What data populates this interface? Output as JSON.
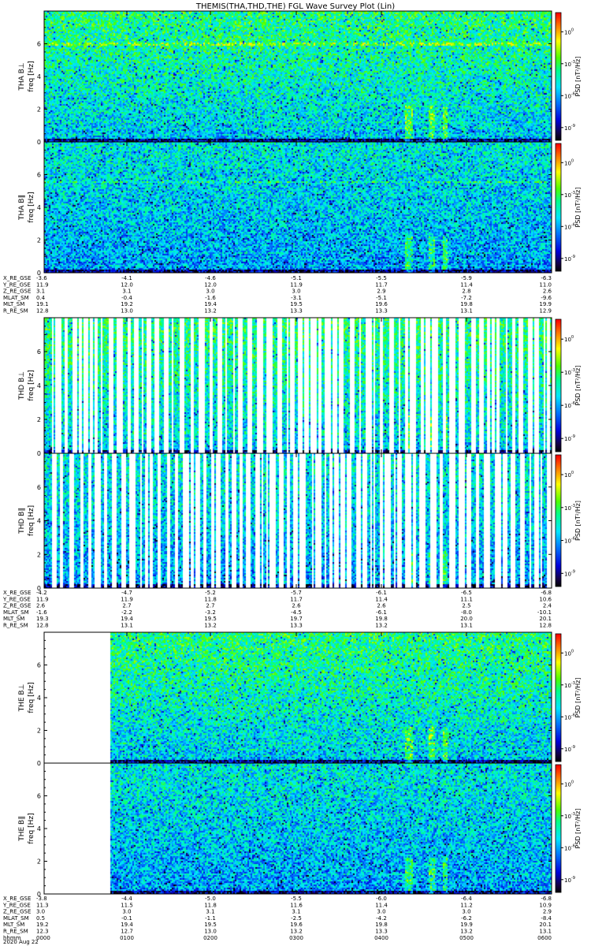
{
  "title": "THEMIS(THA,THD,THE) FGL Wave Survey Plot (Lin)",
  "colorbar_label": "PSD [nT²/Hz]",
  "colorbar_ticks": [
    {
      "exp": 0
    },
    {
      "exp": -3
    },
    {
      "exp": -6
    },
    {
      "exp": -9
    }
  ],
  "chart_data": {
    "type": "heatmap",
    "x_unit": "hhmm",
    "date": "2020 Aug 22",
    "x_ticks": [
      "0000",
      "0100",
      "0200",
      "0300",
      "0400",
      "0500",
      "0600"
    ],
    "x_range": [
      "0000",
      "0600"
    ],
    "ylim": [
      0,
      8
    ],
    "y_ticks": [
      0,
      2,
      4,
      6
    ],
    "color_scale": "log",
    "colormap": "rainbow",
    "panels": [
      {
        "probe": "THA",
        "component": "B⊥",
        "ylabel_probe": "THA B⊥",
        "ylabel_unit": "freq [Hz]",
        "coverage_start_fraction": 0.0,
        "gaps": false
      },
      {
        "probe": "THA",
        "component": "B∥",
        "ylabel_probe": "THA B∥",
        "ylabel_unit": "freq [Hz]",
        "coverage_start_fraction": 0.0,
        "gaps": false
      },
      {
        "probe": "THD",
        "component": "B⊥",
        "ylabel_probe": "THD B⊥",
        "ylabel_unit": "freq [Hz]",
        "coverage_start_fraction": 0.0,
        "gaps": true
      },
      {
        "probe": "THD",
        "component": "B∥",
        "ylabel_probe": "THD B∥",
        "ylabel_unit": "freq [Hz]",
        "coverage_start_fraction": 0.0,
        "gaps": true
      },
      {
        "probe": "THE",
        "component": "B⊥",
        "ylabel_probe": "THE B⊥",
        "ylabel_unit": "freq [Hz]",
        "coverage_start_fraction": 0.13,
        "gaps": false
      },
      {
        "probe": "THE",
        "component": "B∥",
        "ylabel_probe": "THE B∥",
        "ylabel_unit": "freq [Hz]",
        "coverage_start_fraction": 0.13,
        "gaps": false
      }
    ],
    "ephemeris_blocks": [
      {
        "probe": "THA",
        "rows": [
          {
            "label": "X_RE_GSE",
            "values": [
              "-3.6",
              "-4.1",
              "-4.6",
              "-5.1",
              "-5.5",
              "-5.9",
              "-6.3"
            ]
          },
          {
            "label": "Y_RE_GSE",
            "values": [
              "11.9",
              "12.0",
              "12.0",
              "11.9",
              "11.7",
              "11.4",
              "11.0"
            ]
          },
          {
            "label": "Z_RE_GSE",
            "values": [
              "3.1",
              "3.1",
              "3.0",
              "3.0",
              "2.9",
              "2.8",
              "2.6"
            ]
          },
          {
            "label": "MLAT_SM",
            "values": [
              "0.4",
              "-0.4",
              "-1.6",
              "-3.1",
              "-5.1",
              "-7.2",
              "-9.6"
            ]
          },
          {
            "label": "MLT_SM",
            "values": [
              "19.1",
              "19.2",
              "19.4",
              "19.5",
              "19.6",
              "19.8",
              "19.9"
            ]
          },
          {
            "label": "R_RE_SM",
            "values": [
              "12.8",
              "13.0",
              "13.2",
              "13.3",
              "13.3",
              "13.1",
              "12.9"
            ]
          }
        ]
      },
      {
        "probe": "THD",
        "rows": [
          {
            "label": "X_RE_GSE",
            "values": [
              "-4.2",
              "-4.7",
              "-5.2",
              "-5.7",
              "-6.1",
              "-6.5",
              "-6.8"
            ]
          },
          {
            "label": "Y_RE_GSE",
            "values": [
              "11.9",
              "11.9",
              "11.8",
              "11.7",
              "11.4",
              "11.1",
              "10.6"
            ]
          },
          {
            "label": "Z_RE_GSE",
            "values": [
              "2.6",
              "2.7",
              "2.7",
              "2.6",
              "2.6",
              "2.5",
              "2.4"
            ]
          },
          {
            "label": "MLAT_SM",
            "values": [
              "-1.6",
              "-2.2",
              "-3.2",
              "-4.5",
              "-6.1",
              "-8.0",
              "-10.1"
            ]
          },
          {
            "label": "MLT_SM",
            "values": [
              "19.3",
              "19.4",
              "19.5",
              "19.7",
              "19.8",
              "20.0",
              "20.1"
            ]
          },
          {
            "label": "R_RE_SM",
            "values": [
              "12.8",
              "13.1",
              "13.2",
              "13.3",
              "13.2",
              "13.1",
              "12.8"
            ]
          }
        ]
      },
      {
        "probe": "THE",
        "rows": [
          {
            "label": "X_RE_GSE",
            "values": [
              "-3.8",
              "-4.4",
              "-5.0",
              "-5.5",
              "-6.0",
              "-6.4",
              "-6.8"
            ]
          },
          {
            "label": "Y_RE_GSE",
            "values": [
              "11.3",
              "11.5",
              "11.8",
              "11.6",
              "11.4",
              "11.2",
              "10.9"
            ]
          },
          {
            "label": "Z_RE_GSE",
            "values": [
              "3.0",
              "3.0",
              "3.1",
              "3.1",
              "3.0",
              "3.0",
              "2.9"
            ]
          },
          {
            "label": "MLAT_SM",
            "values": [
              "0.5",
              "-0.1",
              "-1.1",
              "-2.5",
              "-4.2",
              "-6.2",
              "-8.4"
            ]
          },
          {
            "label": "MLT_SM",
            "values": [
              "19.2",
              "19.4",
              "19.5",
              "19.6",
              "19.8",
              "19.9",
              "20.1"
            ]
          },
          {
            "label": "R_RE_SM",
            "values": [
              "12.3",
              "12.7",
              "13.0",
              "13.2",
              "13.3",
              "13.2",
              "13.1"
            ]
          },
          {
            "label": "hhmm",
            "values": [
              "0000",
              "0100",
              "0200",
              "0300",
              "0400",
              "0500",
              "0600"
            ]
          }
        ]
      }
    ],
    "date_label": "2020 Aug 22"
  }
}
